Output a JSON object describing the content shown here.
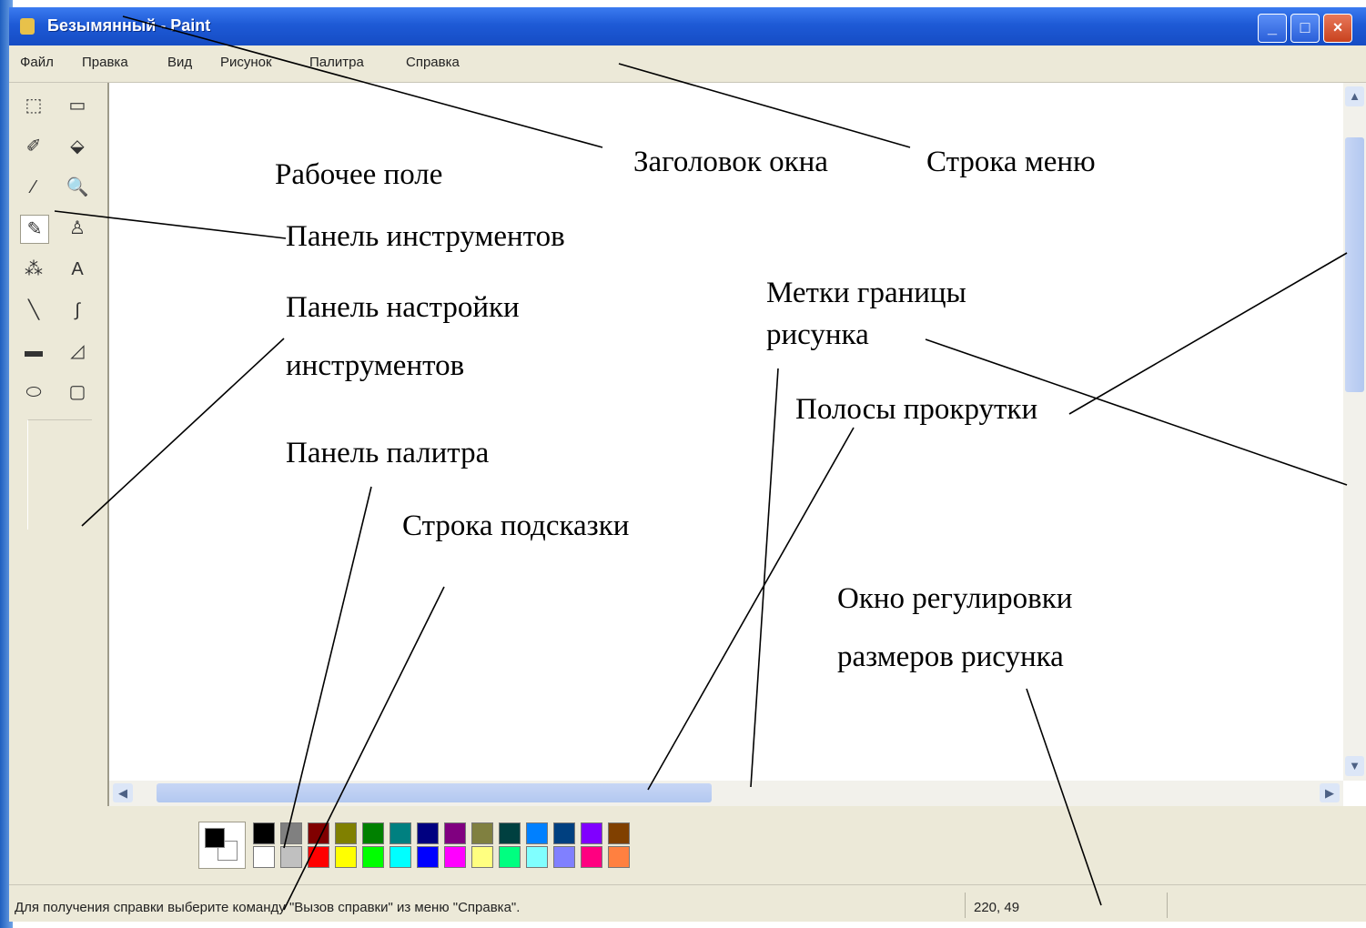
{
  "window": {
    "title": "Безымянный - Paint",
    "buttons": {
      "minimize": "_",
      "maximize": "□",
      "close": "×"
    }
  },
  "menu": {
    "items": [
      "Файл",
      "Правка",
      "Вид",
      "Рисунок",
      "Палитра",
      "Справка"
    ]
  },
  "toolbox": {
    "tools": [
      {
        "name": "free-select-tool-icon",
        "glyph": "⬚"
      },
      {
        "name": "rect-select-tool-icon",
        "glyph": "▭"
      },
      {
        "name": "eraser-tool-icon",
        "glyph": "✐"
      },
      {
        "name": "fill-tool-icon",
        "glyph": "⬙"
      },
      {
        "name": "color-picker-tool-icon",
        "glyph": "⁄"
      },
      {
        "name": "magnifier-tool-icon",
        "glyph": "🔍"
      },
      {
        "name": "pencil-tool-icon",
        "glyph": "✎"
      },
      {
        "name": "brush-tool-icon",
        "glyph": "♙"
      },
      {
        "name": "airbrush-tool-icon",
        "glyph": "⁂"
      },
      {
        "name": "text-tool-icon",
        "glyph": "A"
      },
      {
        "name": "line-tool-icon",
        "glyph": "╲"
      },
      {
        "name": "curve-tool-icon",
        "glyph": "∫"
      },
      {
        "name": "rectangle-tool-icon",
        "glyph": "▬"
      },
      {
        "name": "polygon-tool-icon",
        "glyph": "◿"
      },
      {
        "name": "ellipse-tool-icon",
        "glyph": "⬭"
      },
      {
        "name": "rounded-rect-tool-icon",
        "glyph": "▢"
      }
    ],
    "active_tool": "pencil-tool-icon"
  },
  "palette": {
    "top_row": [
      "#000000",
      "#808080",
      "#800000",
      "#808000",
      "#008000",
      "#008080",
      "#000080",
      "#800080",
      "#808040",
      "#004040",
      "#0080ff",
      "#004080",
      "#8000ff",
      "#804000"
    ],
    "bottom_row": [
      "#ffffff",
      "#c0c0c0",
      "#ff0000",
      "#ffff00",
      "#00ff00",
      "#00ffff",
      "#0000ff",
      "#ff00ff",
      "#ffff80",
      "#00ff80",
      "#80ffff",
      "#8080ff",
      "#ff0080",
      "#ff8040"
    ],
    "foreground": "#000000",
    "background": "#ffffff"
  },
  "statusbar": {
    "hint": "Для получения справки выберите команду \"Вызов справки\" из меню \"Справка\".",
    "coords": "220, 49"
  },
  "annotations": {
    "title": "Заголовок окна",
    "menu": "Строка меню",
    "workspace": "Рабочее поле",
    "toolbox": "Панель инструментов",
    "tool_settings_1": "Панель настройки",
    "tool_settings_2": "инструментов",
    "border_marks_1": "Метки границы",
    "border_marks_2": "рисунка",
    "scrollbars": "Полосы прокрутки",
    "palette": "Панель палитра",
    "hint_line": "Строка подсказки",
    "resize_1": "Окно регулировки",
    "resize_2": "размеров рисунка"
  }
}
